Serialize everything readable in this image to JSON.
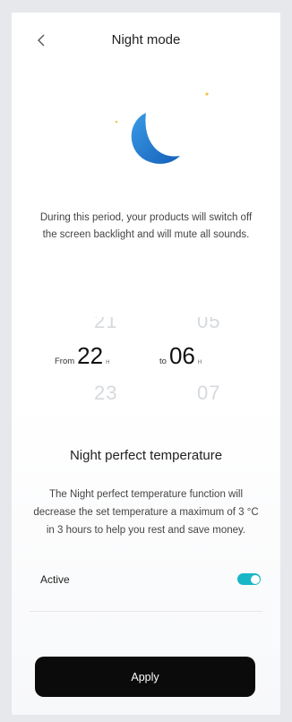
{
  "header": {
    "title": "Night mode"
  },
  "description": "During this period, your products will switch off the screen backlight and will mute all sounds.",
  "pickers": {
    "from": {
      "label": "From",
      "prev": "21",
      "value": "22",
      "next": "23",
      "unit": "H"
    },
    "to": {
      "label": "to",
      "prev": "05",
      "value": "06",
      "next": "07",
      "unit": "H"
    }
  },
  "temperature": {
    "title": "Night perfect temperature",
    "description": "The Night perfect temperature function will decrease the set temperature a maximum of 3 °C in 3 hours to help you rest and save money.",
    "active_label": "Active",
    "active": true
  },
  "apply_label": "Apply",
  "colors": {
    "accent": "#19b6c6",
    "moon": "#1a73c9",
    "star": "#f2c64a",
    "button": "#0b0b0b"
  }
}
